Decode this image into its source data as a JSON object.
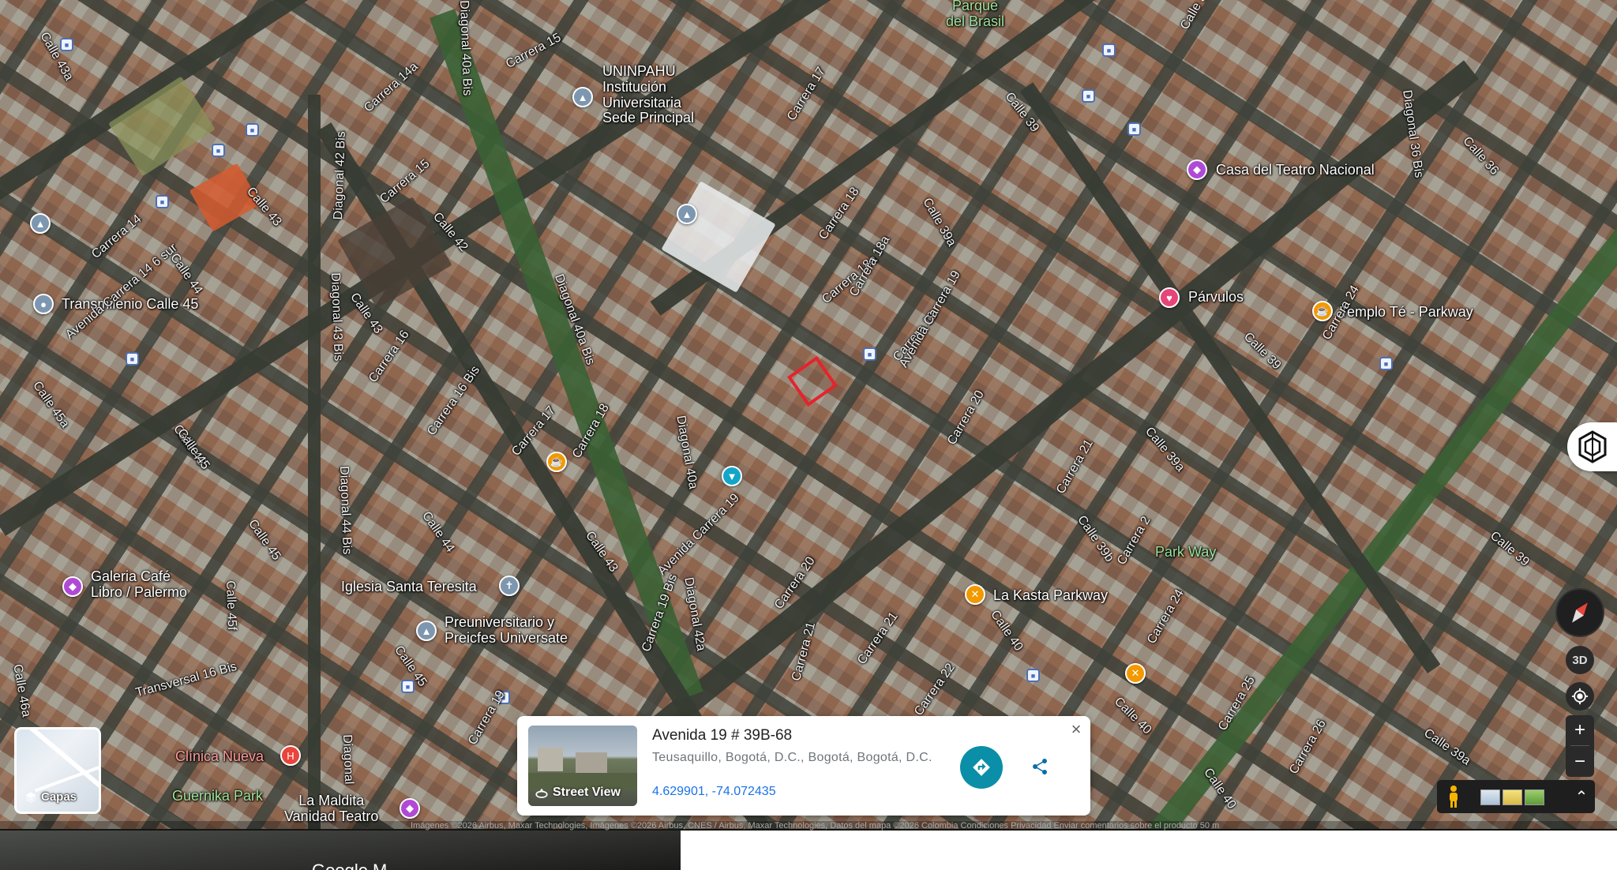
{
  "map": {
    "poi_labels": [
      {
        "id": "parque-brasil",
        "text": "Parque\ndel Brasil"
      },
      {
        "id": "uninpahu",
        "text": "UNINPAHU\nInstitución\nUniversitaria\nSede Principal"
      },
      {
        "id": "casa-teatro",
        "text": "Casa del Teatro Nacional"
      },
      {
        "id": "transmilenio",
        "text": "Transmilenio Calle 45"
      },
      {
        "id": "parvulos",
        "text": "Párvulos"
      },
      {
        "id": "templo-te",
        "text": "Templo Té - Parkway"
      },
      {
        "id": "park-way",
        "text": "Park Way"
      },
      {
        "id": "la-kasta",
        "text": "La Kasta Parkway"
      },
      {
        "id": "galeria-cafe",
        "text": "Galeria Café\nLibro / Palermo"
      },
      {
        "id": "iglesia",
        "text": "Iglesia Santa Teresita"
      },
      {
        "id": "preuniversitario",
        "text": "Preuniversitario y\nPreicfes Universate"
      },
      {
        "id": "clinica",
        "text": "Clínica Nueva"
      },
      {
        "id": "guernika",
        "text": "Guernika Park"
      },
      {
        "id": "la-maldita",
        "text": "La Maldita\nVanidad Teatro"
      }
    ],
    "street_labels": [
      "Calle 43a",
      "Carrera 14a",
      "Diagonal 40a Bis",
      "Carrera 15",
      "Carrera 17",
      "Calle 39",
      "Calle 37",
      "Diagonal 36 Bis",
      "Calle 36",
      "Carrera 14",
      "Avenida Carrera 14 6 sur",
      "Calle 43",
      "Diagonal 42 Bis",
      "Carrera 15",
      "Calle 42",
      "Calle 44",
      "Carrera 18",
      "Carrera 18a",
      "Calle 39a",
      "Carrera 19",
      "Calle 45",
      "Diagonal 43 Bis",
      "Calle 43",
      "Carrera 16",
      "Carrera 16 Bis",
      "Diagonal 40a Bis",
      "Carrera 18a",
      "Avenida Carrera 19",
      "Carrera 20",
      "Carrera 21",
      "Calle 39",
      "Calle 45a",
      "Calle 45",
      "Carrera 17",
      "Carrera 18",
      "Diagonal 40a",
      "Avenida Carrera 19",
      "Calle 39a",
      "Calle 39b",
      "Carrera 24",
      "Calle 39",
      "Diagonal 44 Bis",
      "Calle 44",
      "Calle 43",
      "Calle 45",
      "Calle 45f",
      "Transversal 16 Bis",
      "Carrera 19 Bis",
      "Diagonal 42a",
      "Carrera 20",
      "Carrera 21",
      "Carrera 22",
      "Calle 40",
      "Carrera 24",
      "Carrera 25",
      "Carrera 26",
      "Calle 39a",
      "Calle 40",
      "Calle 45",
      "Carrera 19",
      "Diagonal",
      "Carrera 21",
      "Calle 46a",
      "Calle 40",
      "Carrera 2"
    ]
  },
  "place_card": {
    "title": "Avenida 19 # 39B-68",
    "subtitle": "Teusaquillo, Bogotá, D.C., Bogotá, Bogotá, D.C.",
    "coords": "4.629901, -74.072435",
    "street_view_label": "Street View",
    "close_label": "×"
  },
  "controls": {
    "layers_label": "Capas",
    "btn_3d": "3D",
    "zoom_in": "+",
    "zoom_out": "−",
    "expand": "⌃"
  },
  "attribution": "Imágenes ©2026 Airbus, Maxar Technologies, Imágenes ©2026 Airbus, CNES / Airbus, Maxar Technologies, Datos del mapa ©2026     Colombia     Condiciones     Privacidad     Enviar comentarios sobre el producto     50 m",
  "lower_left_text": "Google M",
  "colors": {
    "accent_teal": "#0b8ea8",
    "link_blue": "#1a73e8",
    "marker_red": "#e5232d",
    "poi_purple": "#b04ad6",
    "poi_pink": "#e6457a",
    "poi_orange": "#f29900",
    "poi_blue": "#4285f4",
    "poi_cyan": "#12a5c9",
    "poi_red": "#e8453c",
    "poi_gray": "#7e97b0"
  },
  "icons": {
    "layers": "layers-icon",
    "street_view": "street-view-icon",
    "directions": "directions-icon",
    "share": "share-icon",
    "close": "close-icon",
    "compass": "compass-icon",
    "locate": "my-location-icon",
    "pegman": "pegman-icon",
    "hexagon": "hexagon-ar-icon"
  }
}
